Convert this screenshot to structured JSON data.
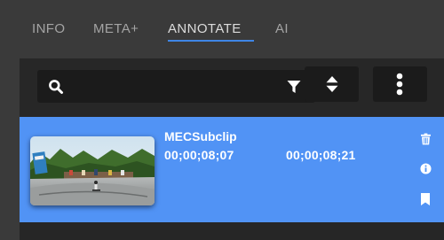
{
  "tabs": [
    {
      "label": "INFO",
      "active": false
    },
    {
      "label": "META+",
      "active": false
    },
    {
      "label": "ANNOTATE",
      "active": true
    },
    {
      "label": "AI",
      "active": false
    }
  ],
  "search": {
    "value": "",
    "placeholder": ""
  },
  "toolbar": {
    "icons": [
      "search-icon",
      "filter-icon",
      "sort-icon",
      "more-vertical-icon"
    ]
  },
  "clips": [
    {
      "name": "MECSubclip",
      "tc_in": "00;00;08;07",
      "tc_out": "00;00;08;21",
      "actions": [
        "trash-icon",
        "info-icon",
        "bookmark-icon"
      ]
    }
  ],
  "colors": {
    "background": "#3a3a3a",
    "panel": "#272727",
    "selected_row": "#5193f5",
    "accent": "#3f86e6"
  }
}
